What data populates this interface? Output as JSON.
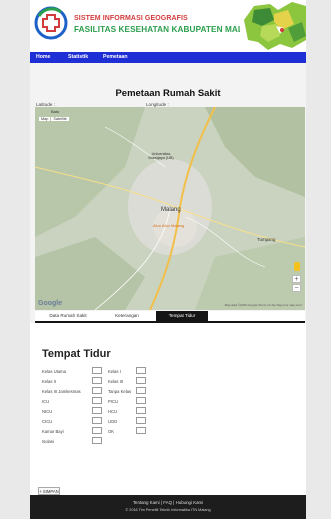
{
  "header": {
    "title_line1": "SISTEM INFORMASI GEOGRAFIS",
    "title_line2": "FASILITAS KESEHATAN KABUPATEN MALANG"
  },
  "nav": {
    "items": [
      "Home",
      "Statistik",
      "Pemetaan"
    ]
  },
  "main": {
    "title": "Pemetaan Rumah Sakit",
    "latitude_label": "Latitude :",
    "longitude_label": "Longitude :"
  },
  "map": {
    "controls": [
      "Map",
      "Satellite"
    ],
    "labels": {
      "universitas": "Universitas Brawijaya (UB)",
      "city": "Malang",
      "alun": "Alun Alun Malang",
      "tumpang": "Tumpang",
      "batu": "Batu"
    },
    "google": "Google",
    "footer": "Map data ©2016 Google  Terms of Use  Report a map error",
    "zoom_in": "+",
    "zoom_out": "−"
  },
  "tabs": {
    "items": [
      "Data Rumah Sakit",
      "Keterangan",
      "Tempat Tidur"
    ],
    "active": "Tempat Tidur"
  },
  "bed": {
    "title": "Tempat Tidur",
    "left_rows": [
      "Kelas Utama",
      "Kelas II",
      "Kelas III Jamkesmas",
      "ICU",
      "NICU",
      "CICU",
      "Kamar Bayi",
      "Isolasi"
    ],
    "right_rows": [
      "Kelas I",
      "Kelas III",
      "Tanpa Kelas",
      "PICU",
      "HCU",
      "UGD",
      "OK"
    ],
    "save_label": "+ SIMPAN"
  },
  "footer": {
    "links": "Tentang Kami   |   FAQ   |   Hubungi Kami",
    "copyright": "© 2016 Tim Peneliti Teknik Informatika ITN Malang"
  },
  "colors": {
    "nav": "#1e2fd6",
    "title_red": "#d23b3b",
    "title_green": "#2a9f4c",
    "footer": "#1d1d1d"
  }
}
